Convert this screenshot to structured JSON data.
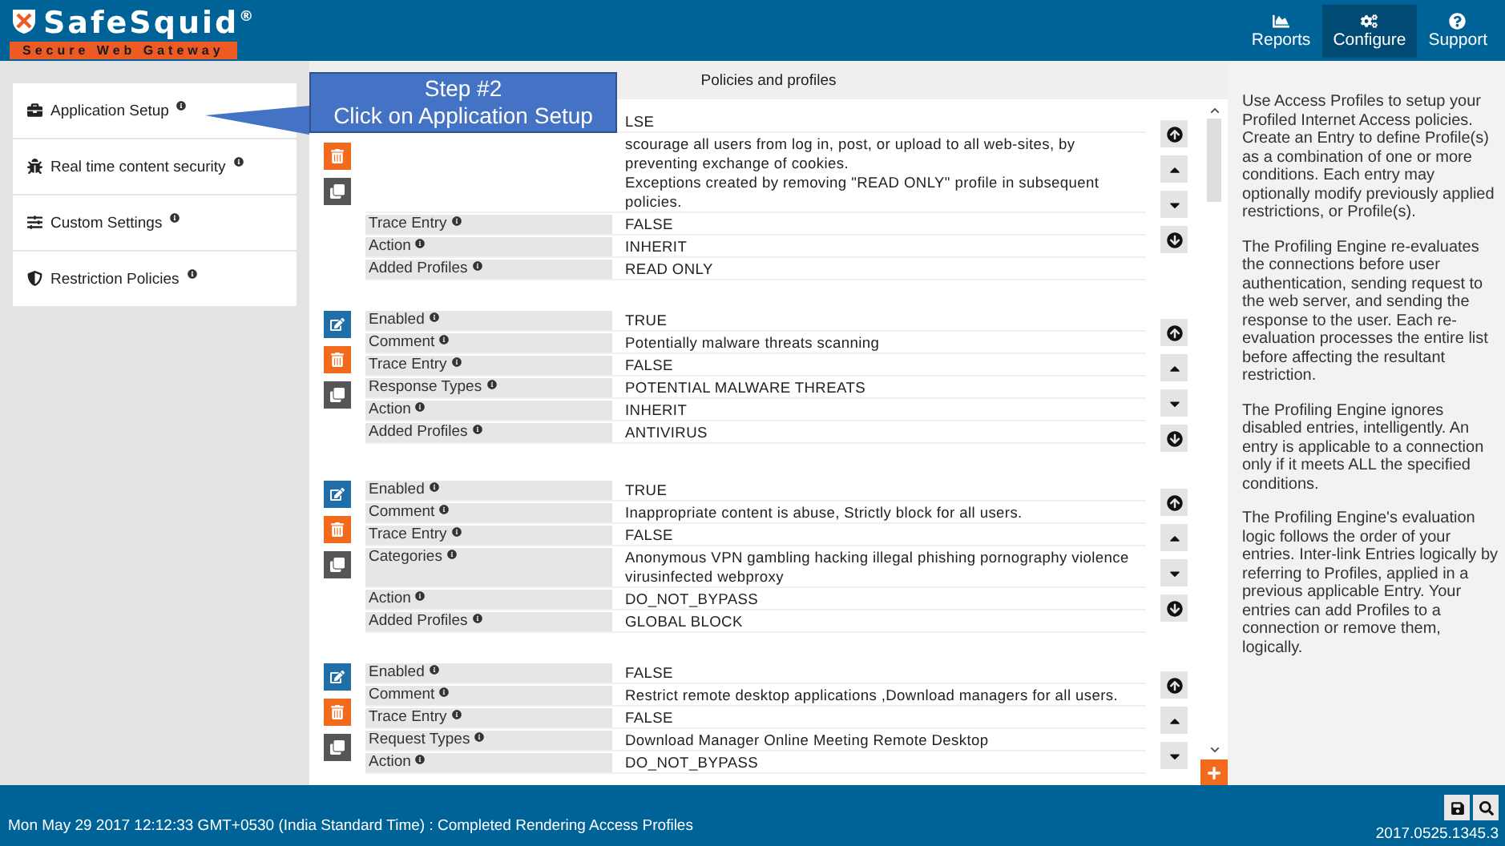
{
  "header": {
    "logo": {
      "name": "SafeSquid",
      "mark": "®",
      "tagline": "Secure Web Gateway"
    },
    "nav": [
      {
        "label": "Reports",
        "selected": false
      },
      {
        "label": "Configure",
        "selected": true
      },
      {
        "label": "Support",
        "selected": false
      }
    ]
  },
  "sidebar": {
    "items": [
      {
        "label": "Application Setup"
      },
      {
        "label": "Real time content security"
      },
      {
        "label": "Custom Settings"
      },
      {
        "label": "Restriction Policies"
      }
    ]
  },
  "callout": {
    "lines": [
      "Step #2",
      "Click on Application Setup"
    ]
  },
  "panel": {
    "title": "Policies and profiles",
    "entries": [
      {
        "edit_visible": false,
        "fields": [
          {
            "value": [
              "LSE"
            ]
          },
          {
            "value": [
              "scourage all users from log in, post, or upload to all web-sites, by preventing exchange of cookies.",
              "Exceptions created by removing \"READ ONLY\" profile in subsequent policies."
            ]
          },
          {
            "label": "Trace Entry",
            "value": [
              "FALSE"
            ]
          },
          {
            "label": "Action",
            "value": [
              "INHERIT"
            ]
          },
          {
            "label": "Added Profiles",
            "value": [
              "READ ONLY"
            ]
          }
        ]
      },
      {
        "edit_visible": true,
        "fields": [
          {
            "label": "Enabled",
            "value": [
              "TRUE"
            ]
          },
          {
            "label": "Comment",
            "value": [
              "Potentially malware threats scanning"
            ]
          },
          {
            "label": "Trace Entry",
            "value": [
              "FALSE"
            ]
          },
          {
            "label": "Response Types",
            "value": [
              "POTENTIAL MALWARE THREATS"
            ]
          },
          {
            "label": "Action",
            "value": [
              "INHERIT"
            ]
          },
          {
            "label": "Added Profiles",
            "value": [
              "ANTIVIRUS"
            ]
          }
        ]
      },
      {
        "edit_visible": true,
        "fields": [
          {
            "label": "Enabled",
            "value": [
              "TRUE"
            ]
          },
          {
            "label": "Comment",
            "value": [
              "Inappropriate content is abuse, Strictly block for all users."
            ]
          },
          {
            "label": "Trace Entry",
            "value": [
              "FALSE"
            ]
          },
          {
            "label": "Categories",
            "value": [
              "Anonymous VPN  gambling  hacking  illegal  phishing  pornography violence  virusinfected  webproxy"
            ]
          },
          {
            "label": "Action",
            "value": [
              "DO_NOT_BYPASS"
            ]
          },
          {
            "label": "Added Profiles",
            "value": [
              "GLOBAL BLOCK"
            ]
          }
        ]
      },
      {
        "edit_visible": true,
        "fields": [
          {
            "label": "Enabled",
            "value": [
              "FALSE"
            ]
          },
          {
            "label": "Comment",
            "value": [
              "Restrict remote desktop applications ,Download managers for all users."
            ]
          },
          {
            "label": "Trace Entry",
            "value": [
              "FALSE"
            ]
          },
          {
            "label": "Request Types",
            "value": [
              "Download Manager  Online Meeting  Remote Desktop"
            ]
          },
          {
            "label": "Action",
            "value": [
              "DO_NOT_BYPASS"
            ]
          }
        ]
      }
    ]
  },
  "help": [
    "Use Access Profiles to setup your Profiled Internet Access policies. Create an Entry to define Profile(s) as a combination of one or more conditions. Each entry may optionally modify previously applied restrictions, or Profile(s).",
    "The Profiling Engine re-evaluates the connections before user authentication, sending request to the web server, and sending the response to the user. Each re-evaluation processes the entire list before affecting the resultant restriction.",
    "The Profiling Engine ignores disabled entries, intelligently. An entry is applicable to a connection only if it meets ALL the specified conditions.",
    "The Profiling Engine's evaluation logic follows the order of your entries. Inter-link Entries logically by referring to Profiles, applied in a previous applicable Entry. Your entries can add Profiles to a connection or remove them, logically."
  ],
  "status_bar": {
    "message": "Mon May 29 2017 12:12:33 GMT+0530 (India Standard Time) : Completed Rendering Access Profiles",
    "version": "2017.0525.1345.3"
  }
}
